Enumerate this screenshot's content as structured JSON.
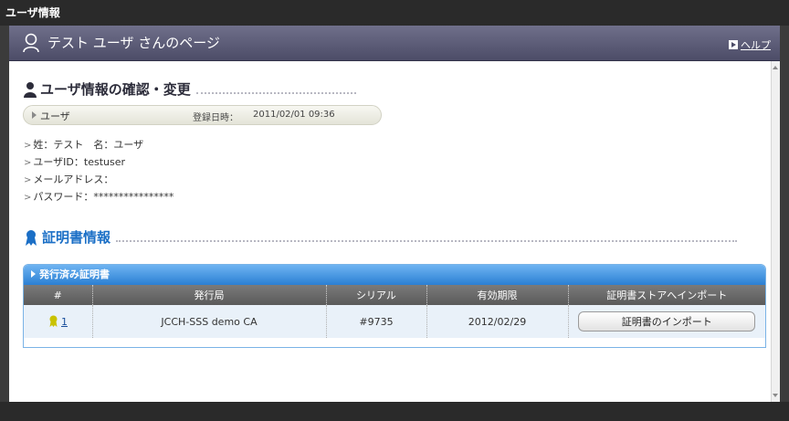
{
  "window": {
    "title": "ユーザ情報"
  },
  "header": {
    "title": "テスト ユーザ さんのページ",
    "help_label": "ヘルプ"
  },
  "section_user": {
    "title": "ユーザ情報の確認・変更",
    "bar_label": "ユーザ",
    "registered_label": "登録日時：",
    "registered_value": "2011/02/01 09:36",
    "fields": [
      {
        "text": "姓：テスト　名：ユーザ"
      },
      {
        "text": "ユーザID：testuser"
      },
      {
        "text": "メールアドレス："
      },
      {
        "text": "パスワード：****************"
      }
    ]
  },
  "section_cert": {
    "title": "証明書情報",
    "card_title": "発行済み証明書",
    "columns": [
      "#",
      "発行局",
      "シリアル",
      "有効期限",
      "証明書ストアへインポート"
    ],
    "rows": [
      {
        "index": "1",
        "issuer": "JCCH-SSS demo CA",
        "serial": "#9735",
        "expires": "2012/02/29",
        "action": "証明書のインポート"
      }
    ]
  },
  "colors": {
    "header_bg": "#5c5c78",
    "accent_blue": "#2a7fd3",
    "award_yellow": "#c9c200",
    "row_bg": "#e9f1f9"
  },
  "icons": {
    "header": "user-icon",
    "section_user": "person-icon",
    "section_cert": "award-icon",
    "help": "help-arrow-icon"
  }
}
